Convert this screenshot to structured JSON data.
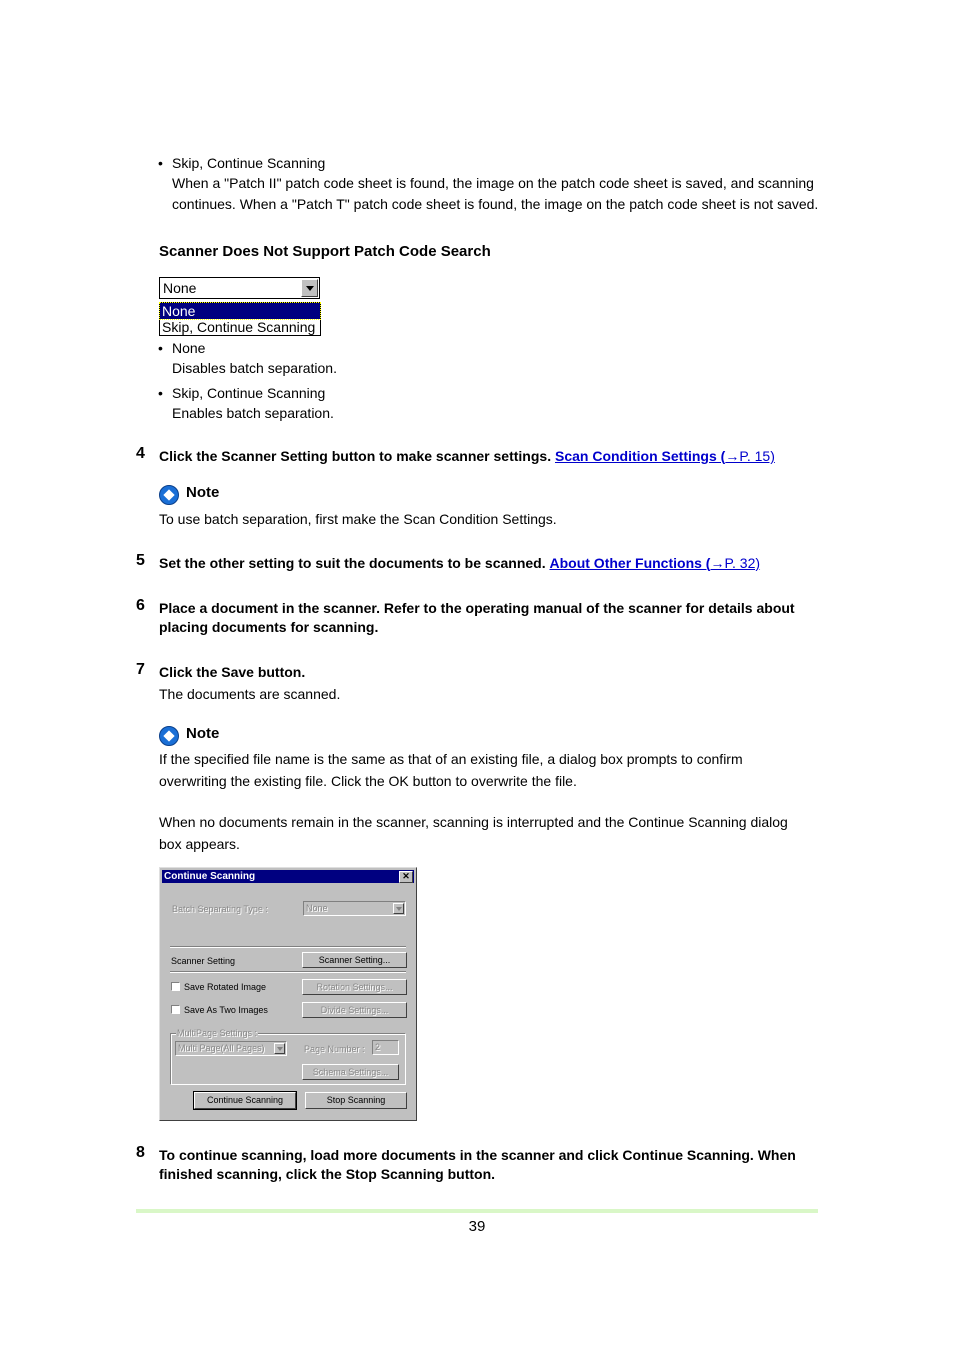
{
  "top_bullet": {
    "title": "Skip, Continue Scanning",
    "line1": "When a \"Patch II\" patch code sheet is found, the image on the patch code sheet is saved, and scanning",
    "line2": "continues. When a \"Patch T\" patch code sheet is found, the image on the patch code sheet is not saved."
  },
  "section_heading": "Scanner Does Not Support Patch Code Search",
  "dropdown": {
    "selected": "None",
    "options": [
      "None",
      "Skip, Continue Scanning"
    ],
    "highlighted_index": 0
  },
  "options_desc": [
    {
      "title": "None",
      "desc": "Disables batch separation."
    },
    {
      "title": "Skip, Continue Scanning",
      "desc": "Enables batch separation."
    }
  ],
  "steps": [
    {
      "num": "4",
      "text": "Click the Scanner Setting button to make scanner settings.",
      "link": "Scan Condition Settings (",
      "link_page": "→P. 15)"
    },
    {
      "num": "5",
      "text": "Set the other setting to suit the documents to be scanned.",
      "link": "About Other Functions (",
      "link_page": "→P. 32)"
    },
    {
      "num": "6",
      "line1": "Place a document in the scanner. Refer to the operating manual of the scanner for details about",
      "line2": "placing documents for scanning."
    },
    {
      "num": "7",
      "text": "Click the Save button.",
      "sub": "The documents are scanned."
    },
    {
      "num": "8",
      "line1": "To continue scanning, load more documents in the scanner and click Continue Scanning. When",
      "line2": "finished scanning, click the Stop Scanning button."
    }
  ],
  "note1": {
    "label": "Note",
    "text": "To use batch separation, first make the Scan Condition Settings."
  },
  "note2": {
    "label": "Note",
    "p1_line1": "If the specified file name is the same as that of an existing file, a dialog box prompts to confirm",
    "p1_line2": "overwriting the existing file. Click the OK button to overwrite the file.",
    "p2_line1": "When no documents remain in the scanner, scanning is interrupted and the Continue Scanning dialog",
    "p2_line2": "box appears."
  },
  "dialog": {
    "title": "Continue Scanning",
    "close": "✕",
    "batch_label": "Batch Separating Type :",
    "batch_value": "None",
    "scanner_setting_label": "Scanner Setting",
    "scanner_setting_button": "Scanner Setting...",
    "save_rotated_label": "Save Rotated Image",
    "rotation_button": "Rotation Settings...",
    "save_two_label": "Save As Two Images",
    "divide_button": "Divide Settings...",
    "multipage_group": "MultiPage Settings :",
    "multipage_value": "Multi Page(All Pages)",
    "page_number_label": "Page Number :",
    "page_number_value": "2",
    "schema_button": "Schema Settings...",
    "continue_button": "Continue Scanning",
    "stop_button": "Stop Scanning"
  },
  "page_number": "39"
}
